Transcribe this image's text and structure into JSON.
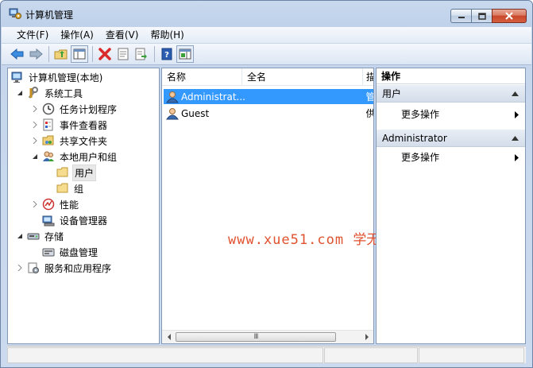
{
  "window": {
    "title": "计算机管理"
  },
  "menu": [
    "文件(F)",
    "操作(A)",
    "查看(V)",
    "帮助(H)"
  ],
  "toolbar": {
    "icons": [
      "back-icon",
      "forward-icon",
      "up-folder-icon",
      "show-tree-icon",
      "delete-icon",
      "properties-icon",
      "export-list-icon",
      "help-icon",
      "show-action-pane-icon"
    ]
  },
  "tree": {
    "root": "计算机管理(本地)",
    "system_tools": "系统工具",
    "task_scheduler": "任务计划程序",
    "event_viewer": "事件查看器",
    "shared_folders": "共享文件夹",
    "local_users_groups": "本地用户和组",
    "users": "用户",
    "groups": "组",
    "performance": "性能",
    "device_manager": "设备管理器",
    "storage": "存储",
    "disk_management": "磁盘管理",
    "services_apps": "服务和应用程序"
  },
  "list": {
    "columns": [
      "名称",
      "全名",
      "描"
    ],
    "rows": [
      {
        "name": "Administrat...",
        "fullname": "",
        "desc": "管"
      },
      {
        "name": "Guest",
        "fullname": "",
        "desc": "供"
      }
    ],
    "scroll_grip": "III"
  },
  "actions": {
    "header": "操作",
    "section1": "用户",
    "section1_item": "更多操作",
    "section2": "Administrator",
    "section2_item": "更多操作"
  },
  "watermark": {
    "url": "www.xue51.com",
    "text": "学无忧"
  },
  "colors": {
    "selection": "#3399ff",
    "watermark": "#e0522f"
  }
}
